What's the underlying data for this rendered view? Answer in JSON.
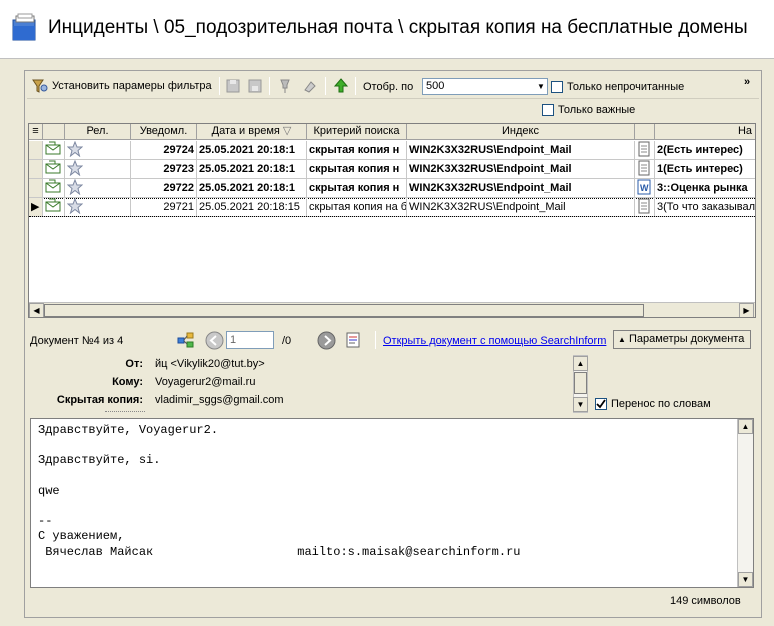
{
  "header": {
    "title": "Инциденты \\ 05_подозрительная почта \\ скрытая копия на бесплатные домены",
    "icon": "incidents-folder-icon"
  },
  "toolbar": {
    "filter_label": "Установить парамеры фильтра",
    "show_label": "Отобр. по",
    "show_value": "500",
    "unread_label": "Только непрочитанные",
    "important_label": "Только важные",
    "more_label": "»"
  },
  "grid": {
    "columns": [
      "",
      "",
      "Рел.",
      "Уведомл.",
      "Дата и время",
      "Критерий поиска",
      "Индекс",
      "",
      "На"
    ],
    "rows": [
      {
        "id": "29724",
        "date": "25.05.2021 20:18:1",
        "criterion": "скрытая копия н",
        "index": "WIN2K3X32RUS\\Endpoint_Mail",
        "name": "2(Есть интерес)",
        "bold": true,
        "doc_icon": "text-doc-icon"
      },
      {
        "id": "29723",
        "date": "25.05.2021 20:18:1",
        "criterion": "скрытая копия н",
        "index": "WIN2K3X32RUS\\Endpoint_Mail",
        "name": "1(Есть интерес)",
        "bold": true,
        "doc_icon": "text-doc-icon"
      },
      {
        "id": "29722",
        "date": "25.05.2021 20:18:1",
        "criterion": "скрытая копия н",
        "index": "WIN2K3X32RUS\\Endpoint_Mail",
        "name": "3::Оценка рынка",
        "bold": true,
        "doc_icon": "word-doc-icon"
      },
      {
        "id": "29721",
        "date": "25.05.2021 20:18:15",
        "criterion": "скрытая копия на б",
        "index": "WIN2K3X32RUS\\Endpoint_Mail",
        "name": "3(То что заказывал",
        "bold": false,
        "doc_icon": "text-doc-icon"
      }
    ]
  },
  "docnav": {
    "doc_label": "Документ №4 из 4",
    "page_value": "1",
    "page_total": "/0",
    "open_link": "Открыть документ с помощью SearchInform",
    "params_label": "Параметры документа"
  },
  "fields": {
    "from_label": "От:",
    "from_value": "йц <Vikylik20@tut.by>",
    "to_label": "Кому:",
    "to_value": "Voyagerur2@mail.ru",
    "bcc_label": "Скрытая копия:",
    "bcc_value": "vladimir_sggs@gmail.com",
    "wrap_label": "Перенос по словам"
  },
  "body": {
    "lines": [
      "Здравствуйте, Voyagerur2.",
      "",
      "Здравствуйте, si.",
      "",
      "qwe",
      "",
      "--",
      "С уважением,",
      " Вячеслав Майсак                    mailto:s.maisak@searchinform.ru"
    ],
    "char_count": "149 символов"
  }
}
